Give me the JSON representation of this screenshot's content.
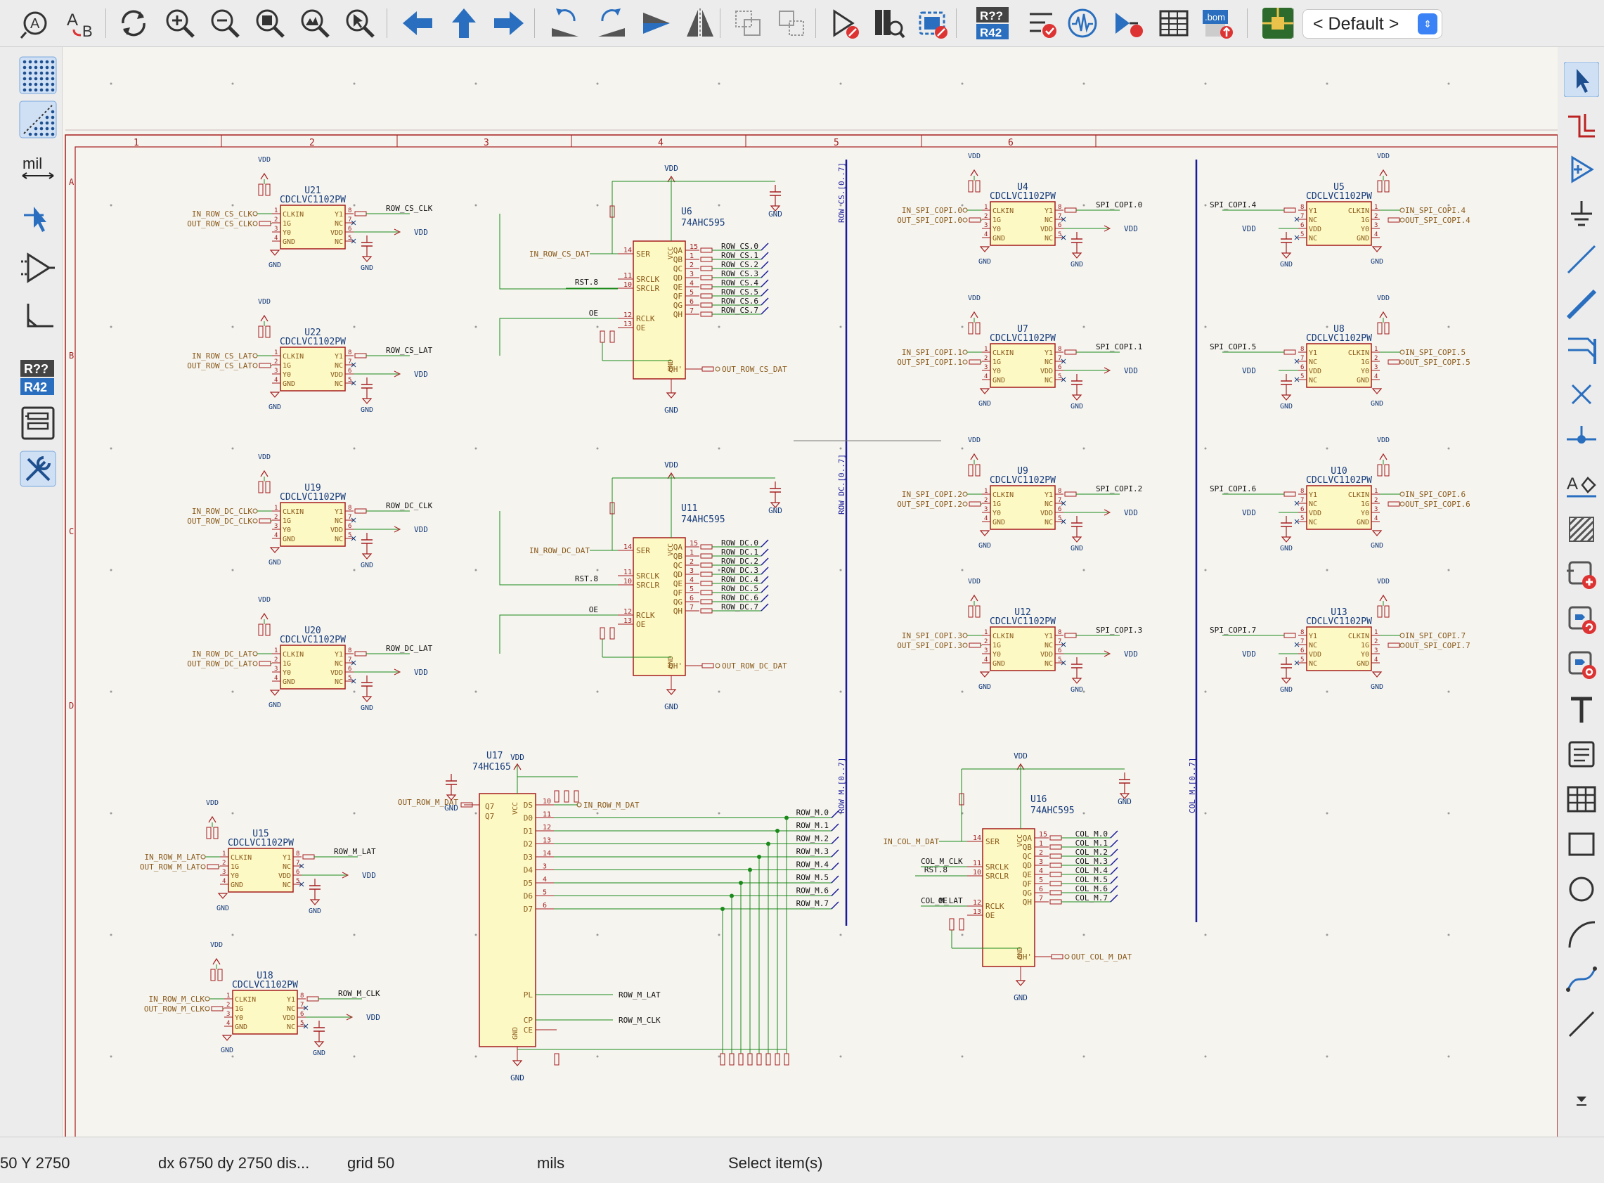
{
  "toolbar": {
    "buttons": [
      "annotate-icon",
      "assign-footprints-icon",
      "refresh-icon",
      "zoom-in-icon",
      "zoom-out-icon",
      "zoom-fit-icon",
      "zoom-objects-icon",
      "zoom-selection-icon",
      "navigate-back-icon",
      "navigate-up-icon",
      "navigate-forward-icon",
      "rotate-ccw-icon",
      "rotate-cw-icon",
      "mirror-vertical-icon",
      "mirror-horizontal-icon",
      "edit-symbol-icon",
      "edit-symbol-lib-icon",
      "simulator-icon",
      "symbol-fields-table-icon",
      "edit-pcb-icon",
      "annotate-r42-icon",
      "erc-icon",
      "simulate-icon",
      "netlist-icon",
      "bom-table-icon",
      "bom-export-icon",
      "pcb-icon"
    ],
    "r42_label_top": "R??",
    "r42_label_bottom": "R42",
    "bom_label": ".bom",
    "layer_preset": "< Default >"
  },
  "left_toolbar": {
    "buttons": [
      "grid-dots-icon",
      "grid-overlay-icon",
      "units-mil-icon",
      "cursor-crosshair-icon",
      "hidden-pins-icon",
      "wire-posture-icon",
      "annotate-r42-icon",
      "hierarchy-navigator-icon",
      "properties-icon"
    ],
    "units_label": "mil",
    "r42_top": "R??",
    "r42_bottom": "R42"
  },
  "right_toolbar": {
    "buttons": [
      "select-icon",
      "highlight-net-icon",
      "add-symbol-icon",
      "add-power-icon",
      "add-wire-icon",
      "add-bus-icon",
      "bus-entry-icon",
      "no-connect-icon",
      "junction-icon",
      "add-label-icon",
      "add-hierarchical-sheet-icon",
      "import-sheet-pin-icon",
      "add-global-label-icon",
      "add-hier-label-icon",
      "add-text-icon",
      "add-textbox-icon",
      "add-table-icon",
      "add-rectangle-icon",
      "add-circle-icon",
      "add-arc-icon",
      "add-bezier-icon",
      "add-line-icon",
      "more-icon"
    ]
  },
  "frame": {
    "columns": [
      "1",
      "2",
      "3",
      "4",
      "5",
      "6"
    ],
    "rows": [
      "A",
      "B",
      "C",
      "D"
    ]
  },
  "schematic": {
    "net_labels": {
      "vdd": "VDD",
      "gnd": "GND",
      "rst8": "RST.8",
      "oe": "OE"
    },
    "u21": {
      "ref": "U21",
      "value": "CDCLVC1102PW",
      "in": "IN_ROW_CS_CLK",
      "out": "OUT_ROW_CS_CLK",
      "net": "ROW_CS_CLK"
    },
    "u22": {
      "ref": "U22",
      "value": "CDCLVC1102PW",
      "in": "IN_ROW_CS_LAT",
      "out": "OUT_ROW_CS_LAT",
      "net": "ROW_CS_LAT"
    },
    "u19": {
      "ref": "U19",
      "value": "CDCLVC1102PW",
      "in": "IN_ROW_DC_CLK",
      "out": "OUT_ROW_DC_CLK",
      "net": "ROW_DC_CLK"
    },
    "u20": {
      "ref": "U20",
      "value": "CDCLVC1102PW",
      "in": "IN_ROW_DC_LAT",
      "out": "OUT_ROW_DC_LAT",
      "net": "ROW_DC_LAT"
    },
    "u15": {
      "ref": "U15",
      "value": "CDCLVC1102PW",
      "in": "IN_ROW_M_LAT",
      "out": "OUT_ROW_M_LAT",
      "net": "ROW_M_LAT"
    },
    "u18": {
      "ref": "U18",
      "value": "CDCLVC1102PW",
      "in": "IN_ROW_M_CLK",
      "out": "OUT_ROW_M_CLK",
      "net": "ROW_M_CLK"
    },
    "u6": {
      "ref": "U6",
      "value": "74AHC595",
      "in": "IN_ROW_CS_DAT",
      "out": "OUT_ROW_CS_DAT",
      "outputs": [
        "ROW_CS.0",
        "ROW_CS.1",
        "ROW_CS.2",
        "ROW_CS.3",
        "ROW_CS.4",
        "ROW_CS.5",
        "ROW_CS.6",
        "ROW_CS.7"
      ],
      "bus": "ROW_CS.[0..7]"
    },
    "u11": {
      "ref": "U11",
      "value": "74AHC595",
      "in": "IN_ROW_DC_DAT",
      "out": "OUT_ROW_DC_DAT",
      "outputs": [
        "ROW_DC.0",
        "ROW_DC.1",
        "ROW_DC.2",
        "ROW_DC.3",
        "ROW_DC.4",
        "ROW_DC.5",
        "ROW_DC.6",
        "ROW_DC.7"
      ],
      "bus": "ROW_DC.[0..7]"
    },
    "u17": {
      "ref": "U17",
      "value": "74HC165",
      "in": "IN_ROW_M_DAT",
      "out": "OUT_ROW_M_DAT",
      "outputs": [
        "ROW_M.0",
        "ROW_M.1",
        "ROW_M.2",
        "ROW_M.3",
        "ROW_M.4",
        "ROW_M.5",
        "ROW_M.6",
        "ROW_M.7"
      ],
      "bus": "ROW_M.[0..7]"
    },
    "u16": {
      "ref": "U16",
      "value": "74AHC595",
      "in": "IN_COL_M_DAT",
      "out": "OUT_COL_M_DAT",
      "clk": "COL_M_CLK",
      "lat": "COL_M_LAT",
      "outputs": [
        "COL_M.0",
        "COL_M.1",
        "COL_M.2",
        "COL_M.3",
        "COL_M.4",
        "COL_M.5",
        "COL_M.6",
        "COL_M.7"
      ],
      "bus": "COL_M.[0..7]"
    },
    "spi_left": [
      {
        "ref": "U4",
        "value": "CDCLVC1102PW",
        "in": "IN_SPI_COPI.0",
        "out": "OUT_SPI_COPI.0",
        "net": "SPI_COPI.0"
      },
      {
        "ref": "U7",
        "value": "CDCLVC1102PW",
        "in": "IN_SPI_COPI.1",
        "out": "OUT_SPI_COPI.1",
        "net": "SPI_COPI.1"
      },
      {
        "ref": "U9",
        "value": "CDCLVC1102PW",
        "in": "IN_SPI_COPI.2",
        "out": "OUT_SPI_COPI.2",
        "net": "SPI_COPI.2"
      },
      {
        "ref": "U12",
        "value": "CDCLVC1102PW",
        "in": "IN_SPI_COPI.3",
        "out": "OUT_SPI_COPI.3",
        "net": "SPI_COPI.3"
      }
    ],
    "spi_right": [
      {
        "ref": "U5",
        "value": "CDCLVC1102PW",
        "in": "IN_SPI_COPI.4",
        "out": "OUT_SPI_COPI.4",
        "net": "SPI_COPI.4"
      },
      {
        "ref": "U8",
        "value": "CDCLVC1102PW",
        "in": "IN_SPI_COPI.5",
        "out": "OUT_SPI_COPI.5",
        "net": "SPI_COPI.5"
      },
      {
        "ref": "U10",
        "value": "CDCLVC1102PW",
        "in": "IN_SPI_COPI.6",
        "out": "OUT_SPI_COPI.6",
        "net": "SPI_COPI.6"
      },
      {
        "ref": "U13",
        "value": "CDCLVC1102PW",
        "in": "IN_SPI_COPI.7",
        "out": "OUT_SPI_COPI.7",
        "net": "SPI_COPI.7"
      }
    ]
  },
  "status": {
    "coords": "50  Y 2750",
    "delta": "dx 6750  dy 2750  dis...",
    "grid": "grid 50",
    "units": "mils",
    "message": "Select item(s)"
  }
}
